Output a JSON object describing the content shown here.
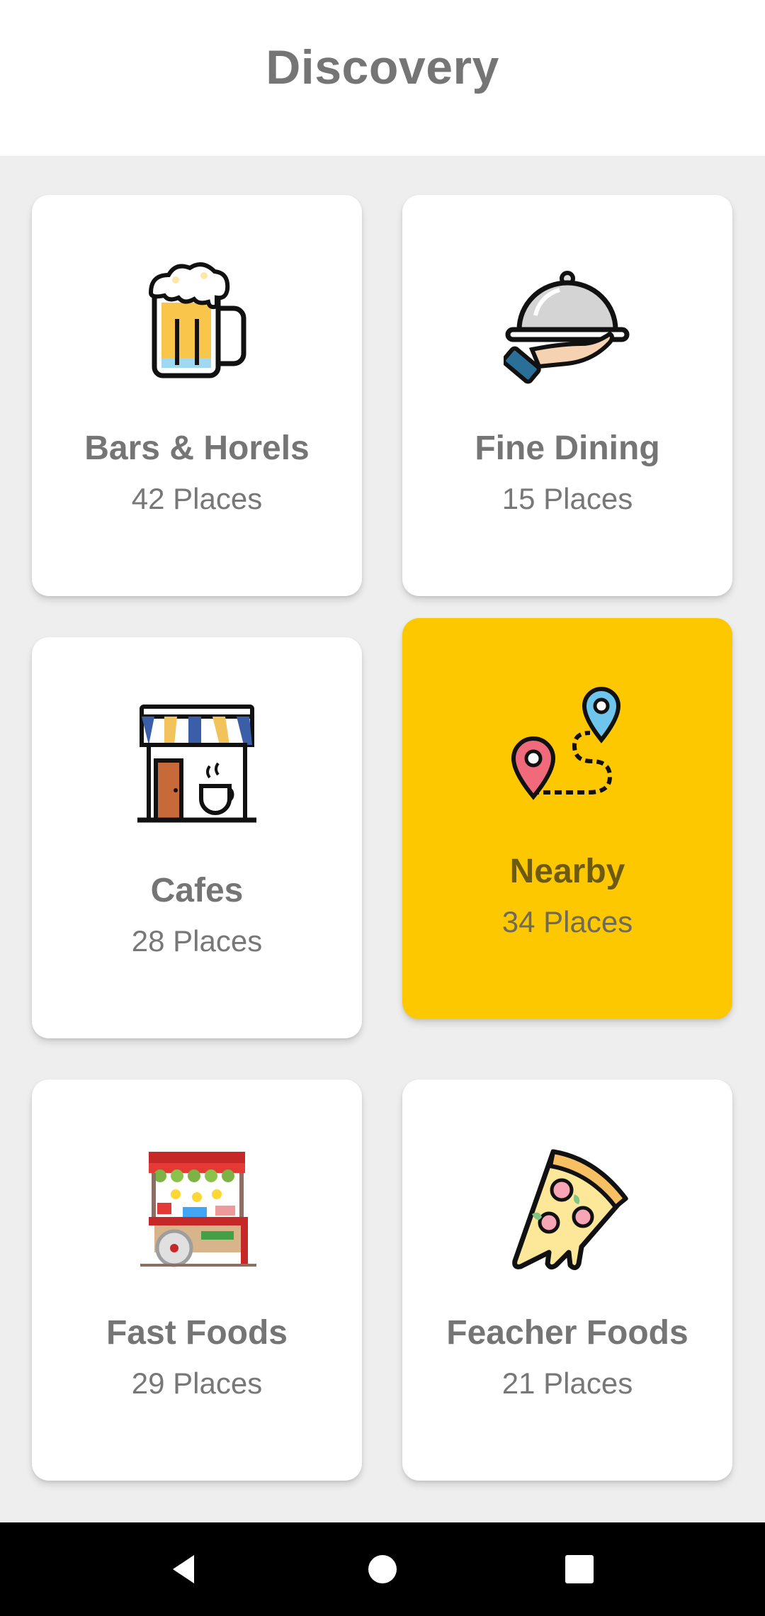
{
  "header": {
    "title": "Discovery"
  },
  "categories": [
    {
      "title": "Bars & Horels",
      "count": "42 Places",
      "icon": "beer-mug-icon"
    },
    {
      "title": "Fine Dining",
      "count": "15 Places",
      "icon": "serving-cloche-icon"
    },
    {
      "title": "Cafes",
      "count": "28 Places",
      "icon": "cafe-storefront-icon"
    },
    {
      "title": "Nearby",
      "count": "34 Places",
      "icon": "map-route-pins-icon",
      "selected": true
    },
    {
      "title": "Fast Foods",
      "count": "29 Places",
      "icon": "food-cart-icon"
    },
    {
      "title": "Feacher Foods",
      "count": "21 Places",
      "icon": "pizza-slice-icon"
    }
  ],
  "colors": {
    "accent": "#fdc800",
    "text": "#757575",
    "background": "#eeeeee"
  },
  "navbar": {
    "buttons": [
      "back-icon",
      "home-icon",
      "recents-icon"
    ]
  }
}
